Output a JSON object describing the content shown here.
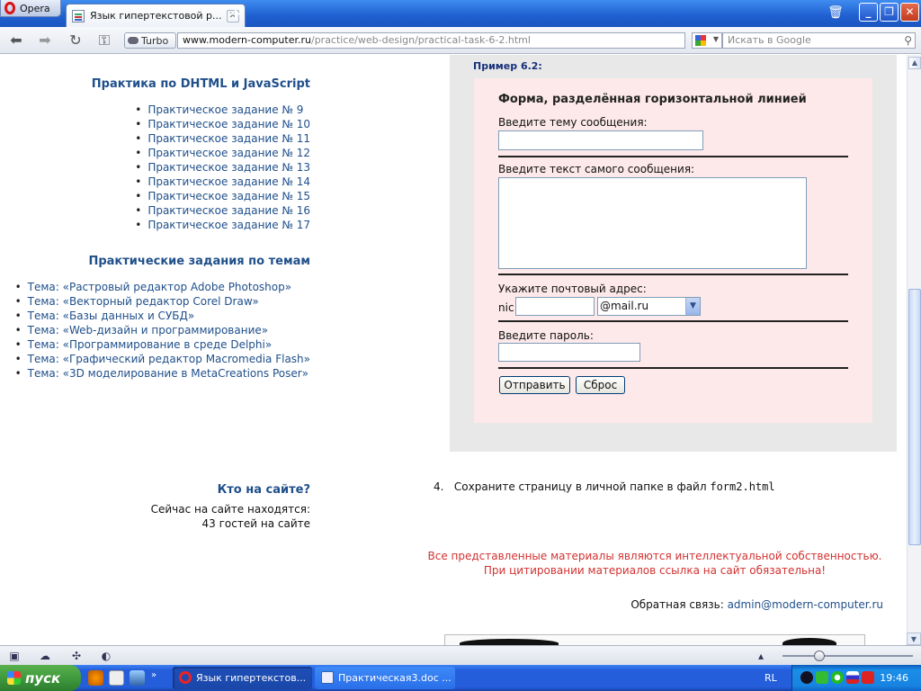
{
  "browser": {
    "opera_label": "Opera",
    "tab_title": "Язык гипертекстовой р...",
    "turbo_label": "Turbo",
    "url_host": "www.modern-computer.ru",
    "url_path": "/practice/web-design/practical-task-6-2.html",
    "search_placeholder": "Искать в Google"
  },
  "sidebar": {
    "section1_title": "Практика по DHTML и JavaScript",
    "section1_links": [
      "Практическое задание № 9",
      "Практическое задание № 10",
      "Практическое задание № 11",
      "Практическое задание № 12",
      "Практическое задание № 13",
      "Практическое задание № 14",
      "Практическое задание № 15",
      "Практическое задание № 16",
      "Практическое задание № 17"
    ],
    "section2_title": "Практические задания по темам",
    "section2_links": [
      "Тема: «Растровый редактор Adobe Photoshop»",
      "Тема: «Векторный редактор Corel Draw»",
      "Тема: «Базы данных и СУБД»",
      "Тема: «Web-дизайн и программирование»",
      "Тема: «Программирование в среде Delphi»",
      "Тема: «Графический редактор Macromedia Flash»",
      "Тема: «3D моделирование в MetaCreations Poser»"
    ],
    "who_title": "Кто на сайте?",
    "who_line1": "Сейчас на сайте находятся:",
    "who_line2": "43 гостей на сайте"
  },
  "example": {
    "label": "Пример 6.2:",
    "form_title": "Форма, разделённая горизонтальной линией",
    "subject_label": "Введите тему сообщения:",
    "message_label": "Введите текст самого сообщения:",
    "email_label": "Укажите почтовый адрес:",
    "nic_label": "nic",
    "domain_selected": "@mail.ru",
    "password_label": "Введите пароль:",
    "submit_label": "Отправить",
    "reset_label": "Сброс"
  },
  "step": {
    "number": "4.",
    "text": "Сохраните страницу в личной папке в файл",
    "filename": "form2.html"
  },
  "footer": {
    "copyright_line1": "Все представленные материалы являются интеллектуальной собственностью.",
    "copyright_line2": "При цитировании материалов ссылка на сайт обязательна!",
    "feedback_label": "Обратная связь:",
    "feedback_email": "admin@modern-computer.ru"
  },
  "taskbar": {
    "start_label": "пуск",
    "task1": "Язык гипертекстов...",
    "task2": "Практическая3.doc ...",
    "lang": "RL",
    "clock": "19:46"
  },
  "colors": {
    "link": "#1f4f8a",
    "copyright_red": "#d33131",
    "pink_box": "#fde9e9",
    "gray_box": "#e8e8e8"
  }
}
